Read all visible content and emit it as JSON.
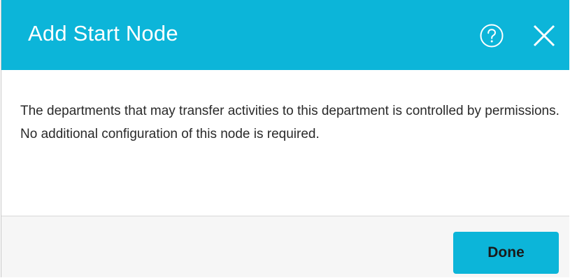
{
  "dialog": {
    "title": "Add Start Node",
    "help_icon": "help-circle-icon",
    "close_icon": "close-x-icon",
    "message": "The departments that may transfer activities to this department is controlled by permissions. No additional configuration of this node is required.",
    "done_label": "Done"
  },
  "colors": {
    "header": "#0cb5d9",
    "button": "#0cb5d9",
    "footer": "#f6f6f6",
    "text": "#2a2a2a"
  }
}
